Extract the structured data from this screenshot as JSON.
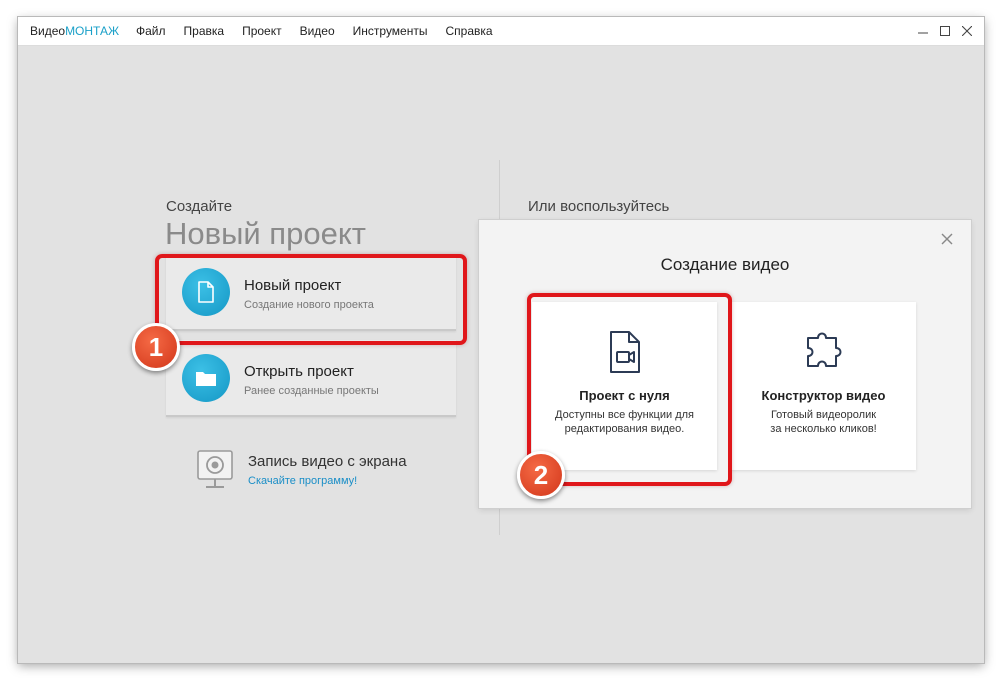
{
  "app": {
    "brand_prefix": "Видео",
    "brand_accent": "МОНТАЖ"
  },
  "menu": [
    "Файл",
    "Правка",
    "Проект",
    "Видео",
    "Инструменты",
    "Справка"
  ],
  "window_controls": {
    "minimize": "minimize-icon",
    "maximize": "maximize-icon",
    "close": "close-icon"
  },
  "left": {
    "label": "Создайте",
    "title": "Новый проект",
    "cards": [
      {
        "title": "Новый проект",
        "subtitle": "Создание нового проекта",
        "icon": "file-icon"
      },
      {
        "title": "Открыть проект",
        "subtitle": "Ранее созданные проекты",
        "icon": "folder-icon"
      }
    ],
    "record": {
      "title": "Запись видео с экрана",
      "link": "Скачайте программу!",
      "icon": "webcam-monitor-icon"
    }
  },
  "right": {
    "label": "Или воспользуйтесь",
    "panel_title": "Создание видео",
    "tiles": [
      {
        "title": "Проект с нуля",
        "desc_lines": [
          "Доступны все функции для",
          "редактирования видео."
        ],
        "icon": "video-file-icon"
      },
      {
        "title": "Конструктор видео",
        "desc_lines": [
          "Готовый видеоролик",
          "за несколько кликов!"
        ],
        "icon": "puzzle-icon"
      }
    ]
  },
  "markers": [
    "1",
    "2"
  ],
  "colors": {
    "accent": "#1aa0c8",
    "highlight": "#e0161a",
    "marker": "#e04a2a",
    "link": "#1a8ec7"
  }
}
